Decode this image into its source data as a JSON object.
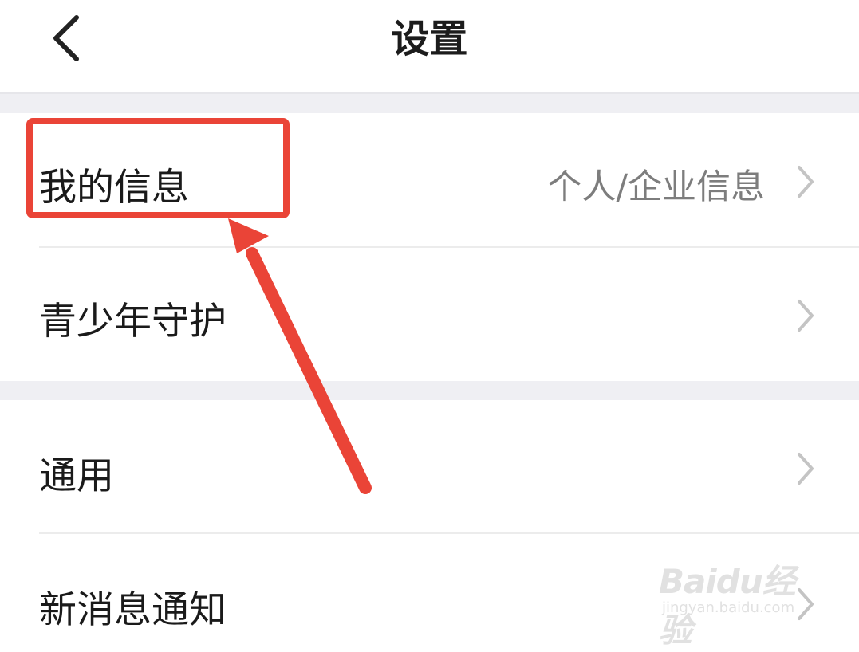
{
  "header": {
    "title": "设置",
    "back_icon": "chevron-left-icon"
  },
  "settings": [
    {
      "label": "我的信息",
      "value": "个人/企业信息",
      "icon": "chevron-right-icon"
    },
    {
      "label": "青少年守护",
      "value": "",
      "icon": "chevron-right-icon"
    },
    {
      "label": "通用",
      "value": "",
      "icon": "chevron-right-icon"
    },
    {
      "label": "新消息通知",
      "value": "",
      "icon": "chevron-right-icon"
    }
  ],
  "annotation": {
    "color": "#ea4437"
  },
  "watermark": {
    "logo": "Baidu经验",
    "url": "jingyan.baidu.com"
  }
}
